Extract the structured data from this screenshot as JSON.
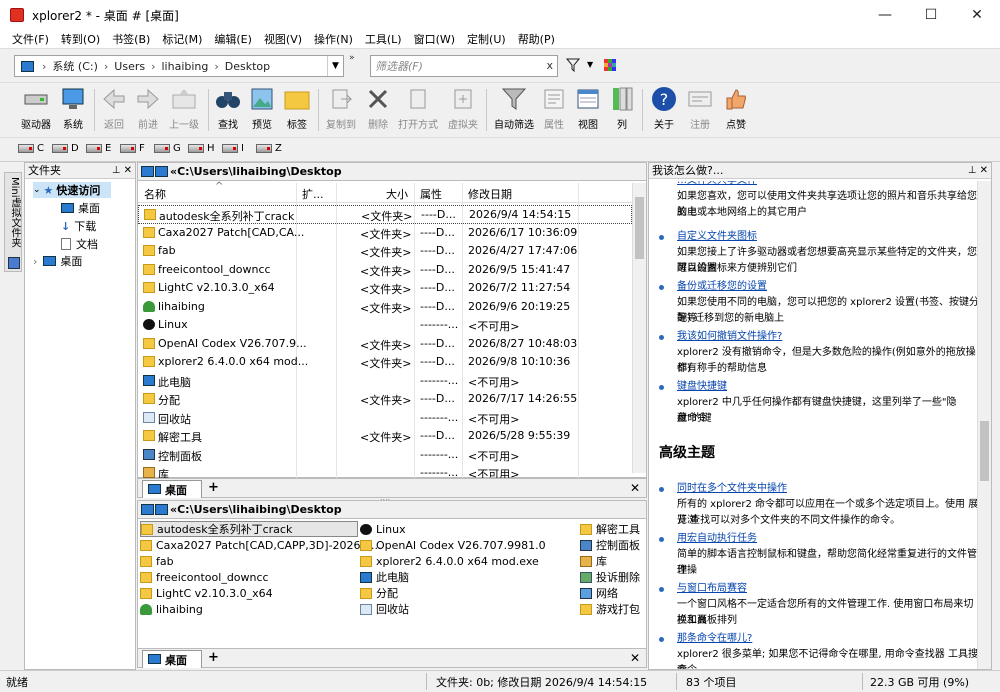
{
  "window": {
    "title": "xplorer2 * - 桌面 # [桌面]",
    "minimize": "—",
    "maximize": "☐",
    "close": "✕"
  },
  "menu": [
    "文件(F)",
    "转到(O)",
    "书签(B)",
    "标记(M)",
    "编辑(E)",
    "视图(V)",
    "操作(N)",
    "工具(L)",
    "窗口(W)",
    "定制(U)",
    "帮助(P)"
  ],
  "address": {
    "crumbs": [
      "系统 (C:)",
      "Users",
      "lihaibing",
      "Desktop"
    ],
    "more": "»",
    "filter_placeholder": "筛选器(F)",
    "filter_clear": "x"
  },
  "toolbar": [
    {
      "label": "驱动器",
      "icon": "drive-icon",
      "enabled": true
    },
    {
      "label": "系统",
      "icon": "computer-icon",
      "enabled": true
    },
    {
      "label": "返回",
      "icon": "back-arrow-icon",
      "enabled": false
    },
    {
      "label": "前进",
      "icon": "forward-arrow-icon",
      "enabled": false
    },
    {
      "label": "上一级",
      "icon": "up-folder-icon",
      "enabled": false
    },
    {
      "label": "查找",
      "icon": "binoculars-icon",
      "enabled": true
    },
    {
      "label": "预览",
      "icon": "preview-icon",
      "enabled": true
    },
    {
      "label": "标签",
      "icon": "tag-folder-icon",
      "enabled": true
    },
    {
      "label": "复制到",
      "icon": "copy-to-icon",
      "enabled": false
    },
    {
      "label": "删除",
      "icon": "delete-x-icon",
      "enabled": false
    },
    {
      "label": "打开方式",
      "icon": "open-with-icon",
      "enabled": false
    },
    {
      "label": "虚拟夹",
      "icon": "virtual-folder-icon",
      "enabled": false
    },
    {
      "label": "自动筛选",
      "icon": "funnel-icon",
      "enabled": true
    },
    {
      "label": "属性",
      "icon": "properties-icon",
      "enabled": false
    },
    {
      "label": "视图",
      "icon": "view-icon",
      "enabled": true
    },
    {
      "label": "列",
      "icon": "columns-icon",
      "enabled": true
    },
    {
      "label": "关于",
      "icon": "help-icon",
      "enabled": true
    },
    {
      "label": "注册",
      "icon": "register-icon",
      "enabled": false
    },
    {
      "label": "点赞",
      "icon": "thumbs-up-icon",
      "enabled": true
    }
  ],
  "drives": [
    "C",
    "D",
    "E",
    "F",
    "G",
    "H",
    "I",
    "Z"
  ],
  "sidetab": {
    "label": "Mini虚拟文件夹"
  },
  "tree": {
    "header": "文件夹",
    "pin": "⊥ ✕",
    "items": [
      {
        "label": "快速访问",
        "level": 0,
        "icon": "star-icon",
        "selected": true,
        "expander": "⌄"
      },
      {
        "label": "桌面",
        "level": 1,
        "icon": "desktop-icon"
      },
      {
        "label": "下载",
        "level": 1,
        "icon": "download-icon"
      },
      {
        "label": "文档",
        "level": 1,
        "icon": "document-icon"
      },
      {
        "label": "桌面",
        "level": 0,
        "icon": "desktop-icon",
        "expander": "›"
      }
    ]
  },
  "pane1": {
    "path": "«C:\\Users\\lihaibing\\Desktop",
    "columns": {
      "name": "名称",
      "ext": "扩...",
      "size": "大小",
      "attr": "属性",
      "date": "修改日期",
      "sort_mark": "^"
    },
    "rows": [
      {
        "name": "autodesk全系列补丁crack",
        "size": "<文件夹>",
        "attr": "----D...",
        "date": "2026/9/4 14:54:15",
        "icon": "folder"
      },
      {
        "name": "Caxa2027 Patch[CAD,CA...",
        "size": "<文件夹>",
        "attr": "----D...",
        "date": "2026/6/17 10:36:09",
        "icon": "folder"
      },
      {
        "name": "fab",
        "size": "<文件夹>",
        "attr": "----D...",
        "date": "2026/4/27 17:47:06",
        "icon": "folder"
      },
      {
        "name": "freeicontool_downcc",
        "size": "<文件夹>",
        "attr": "----D...",
        "date": "2026/9/5 15:41:47",
        "icon": "folder"
      },
      {
        "name": "LightC v2.10.3.0_x64",
        "size": "<文件夹>",
        "attr": "----D...",
        "date": "2026/7/2 11:27:54",
        "icon": "folder"
      },
      {
        "name": "lihaibing",
        "size": "<文件夹>",
        "attr": "----D...",
        "date": "2026/9/6 20:19:25",
        "icon": "user"
      },
      {
        "name": "Linux",
        "size": "",
        "attr": "-------...",
        "date": "<不可用>",
        "icon": "penguin"
      },
      {
        "name": "OpenAI Codex V26.707.9...",
        "size": "<文件夹>",
        "attr": "----D...",
        "date": "2026/8/27 10:48:03",
        "icon": "folder"
      },
      {
        "name": "xplorer2 6.4.0.0 x64 mod...",
        "size": "<文件夹>",
        "attr": "----D...",
        "date": "2026/9/8 10:10:36",
        "icon": "folder"
      },
      {
        "name": "此电脑",
        "size": "",
        "attr": "-------...",
        "date": "<不可用>",
        "icon": "pc"
      },
      {
        "name": "分配",
        "size": "<文件夹>",
        "attr": "----D...",
        "date": "2026/7/17 14:26:55",
        "icon": "folder"
      },
      {
        "name": "回收站",
        "size": "",
        "attr": "-------...",
        "date": "<不可用>",
        "icon": "bin"
      },
      {
        "name": "解密工具",
        "size": "<文件夹>",
        "attr": "----D...",
        "date": "2026/5/28 9:55:39",
        "icon": "folder"
      },
      {
        "name": "控制面板",
        "size": "",
        "attr": "-------...",
        "date": "<不可用>",
        "icon": "cp"
      },
      {
        "name": "库",
        "size": "",
        "attr": "-------...",
        "date": "<不可用>",
        "icon": "lib"
      }
    ],
    "tab": "桌面",
    "tab_plus": "+",
    "tab_close": "✕"
  },
  "pane2": {
    "path": "«C:\\Users\\lihaibing\\Desktop",
    "col1": [
      {
        "name": "autodesk全系列补丁crack",
        "icon": "folder",
        "selected": true
      },
      {
        "name": "Caxa2027 Patch[CAD,CAPP,3D]-2026.0...",
        "icon": "folder"
      },
      {
        "name": "fab",
        "icon": "folder"
      },
      {
        "name": "freeicontool_downcc",
        "icon": "folder"
      },
      {
        "name": "LightC v2.10.3.0_x64",
        "icon": "folder"
      },
      {
        "name": "lihaibing",
        "icon": "user"
      }
    ],
    "col2": [
      {
        "name": "Linux",
        "icon": "penguin"
      },
      {
        "name": "OpenAI Codex V26.707.9981.0",
        "icon": "folder"
      },
      {
        "name": "xplorer2 6.4.0.0 x64 mod.exe",
        "icon": "folder"
      },
      {
        "name": "此电脑",
        "icon": "pc"
      },
      {
        "name": "分配",
        "icon": "folder"
      },
      {
        "name": "回收站",
        "icon": "bin"
      }
    ],
    "col3": [
      {
        "name": "解密工具",
        "icon": "folder"
      },
      {
        "name": "控制面板",
        "icon": "cp"
      },
      {
        "name": "库",
        "icon": "lib"
      },
      {
        "name": "投诉删除",
        "icon": "recyc"
      },
      {
        "name": "网络",
        "icon": "net"
      },
      {
        "name": "游戏打包",
        "icon": "game"
      }
    ],
    "tab": "桌面",
    "tab_plus": "+",
    "tab_close": "✕"
  },
  "help": {
    "header": "我该怎么做?...",
    "pin": "⊥ ✕",
    "top_partial": "…文件夹共享文件",
    "top_desc": [
      "如果您喜欢，您可以使用文件夹共享选项让您的照片和音乐共享给您的电",
      "脑上或本地网络上的其它用户"
    ],
    "items1": [
      {
        "link": "自定义文件夹图标",
        "desc": [
          "如果您接上了许多驱动器或者您想要高亮显示某些特定的文件夹，您可以设置",
          "醒目的图标来方便辨别它们"
        ]
      },
      {
        "link": "备份或迁移您的设置",
        "desc": [
          "如果您使用不同的电脑，您可以把您的 xplorer2 设置(书签、按键分配等",
          "等) 迁移到您的新电脑上"
        ]
      },
      {
        "link": "我该如何撤销文件操作?",
        "desc": [
          "xplorer2 没有撤销命令，但是大多数危险的操作(例如意外的拖放操作)",
          "都有称手的帮助信息"
        ]
      },
      {
        "link": "键盘快捷键",
        "desc": [
          "xplorer2 中几乎任何操作都有键盘快捷键，这里列举了一些\"隐藏\"的键",
          "盘命令"
        ]
      }
    ],
    "section": "高级主题",
    "items2": [
      {
        "link": "同时在多个文件夹中操作",
        "desc": [
          "所有的 xplorer2 命令都可以应用在一个或多个选定项目上。使用 展开浏",
          "览 查找可以对多个文件夹的不同文件操作的命令。"
        ]
      },
      {
        "link": "用宏自动执行任务",
        "desc": [
          "简单的脚本语言控制鼠标和键盘，帮助您简化经常重复进行的文件管理操",
          "作"
        ]
      },
      {
        "link": "与窗口布局赛容",
        "desc": [
          "一个窗口风格不一定适合您所有的文件管理工作. 使用窗口布局来切换工具",
          "栏和面板排列"
        ]
      },
      {
        "link": "那条命令在哪儿?",
        "desc": [
          "xplorer2 很多菜单; 如果您不记得命令在哪里, 用命令查找器 工具搜索",
          "命令。"
        ]
      }
    ]
  },
  "status": {
    "left": "就绪",
    "info": "文件夹: 0b; 修改日期 2026/9/4 14:54:15",
    "count": "83 个项目",
    "disk": "22.3 GB 可用 (9%)"
  }
}
